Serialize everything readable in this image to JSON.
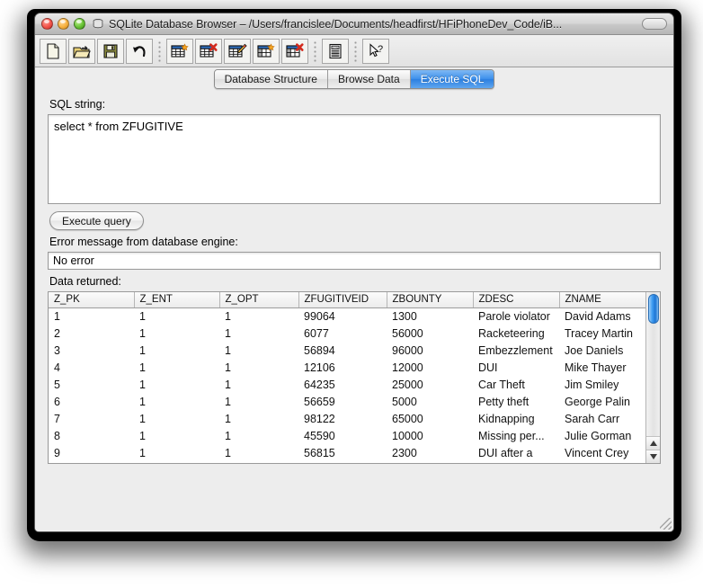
{
  "window": {
    "title": "SQLite Database Browser – /Users/francislee/Documents/headfirst/HFiPhoneDev_Code/iB...",
    "close_label": "close",
    "minimize_label": "minimize",
    "maximize_label": "zoom",
    "doc_icon": "database-icon",
    "toolbar_toggle": "toolbar-toggle-pill"
  },
  "toolbar": {
    "buttons": [
      {
        "name": "new-database",
        "icon": "new-document-icon"
      },
      {
        "name": "open-database",
        "icon": "open-folder-icon"
      },
      {
        "name": "save-database",
        "icon": "floppy-save-icon"
      },
      {
        "name": "revert-changes",
        "icon": "undo-arrow-icon"
      },
      {
        "name": "create-table",
        "icon": "table-new-icon"
      },
      {
        "name": "delete-table",
        "icon": "table-delete-icon"
      },
      {
        "name": "modify-table",
        "icon": "table-edit-icon"
      },
      {
        "name": "create-index",
        "icon": "index-new-icon"
      },
      {
        "name": "delete-index",
        "icon": "index-delete-icon"
      },
      {
        "name": "view-log",
        "icon": "log-document-icon"
      },
      {
        "name": "help",
        "icon": "pointer-question-icon"
      }
    ]
  },
  "tabs": [
    {
      "label": "Database Structure",
      "active": false
    },
    {
      "label": "Browse Data",
      "active": false
    },
    {
      "label": "Execute SQL",
      "active": true
    }
  ],
  "sql_panel": {
    "sql_label": "SQL string:",
    "sql_value": "select * from ZFUGITIVE",
    "execute_label": "Execute query",
    "error_label": "Error message from database engine:",
    "error_value": "No error",
    "data_label": "Data returned:"
  },
  "results": {
    "columns": [
      "Z_PK",
      "Z_ENT",
      "Z_OPT",
      "ZFUGITIVEID",
      "ZBOUNTY",
      "ZDESC",
      "ZNAME"
    ],
    "rows": [
      [
        "1",
        "1",
        "1",
        "99064",
        "1300",
        "Parole violator",
        "David Adams"
      ],
      [
        "2",
        "1",
        "1",
        "6077",
        "56000",
        "Racketeering",
        "Tracey Martin"
      ],
      [
        "3",
        "1",
        "1",
        "56894",
        "96000",
        "Embezzlement",
        "Joe Daniels"
      ],
      [
        "4",
        "1",
        "1",
        "12106",
        "12000",
        "DUI",
        "Mike Thayer"
      ],
      [
        "5",
        "1",
        "1",
        "64235",
        "25000",
        "Car Theft",
        "Jim Smiley"
      ],
      [
        "6",
        "1",
        "1",
        "56659",
        "5000",
        "Petty theft",
        "George Palin"
      ],
      [
        "7",
        "1",
        "1",
        "98122",
        "65000",
        "Kidnapping",
        "Sarah Carr"
      ],
      [
        "8",
        "1",
        "1",
        "45590",
        "10000",
        "Missing per...",
        "Julie Gorman"
      ],
      [
        "9",
        "1",
        "1",
        "56815",
        "2300",
        "DUI after a",
        "Vincent Crey"
      ]
    ]
  },
  "scrollbar": {
    "up_arrow": "scroll-up-arrow",
    "down_arrow": "scroll-down-arrow",
    "thumb": "scroll-thumb"
  },
  "colors": {
    "tab_active": "#3e91ec",
    "scroll_thumb": "#3f9df2",
    "window_chrome": "#ededed"
  }
}
